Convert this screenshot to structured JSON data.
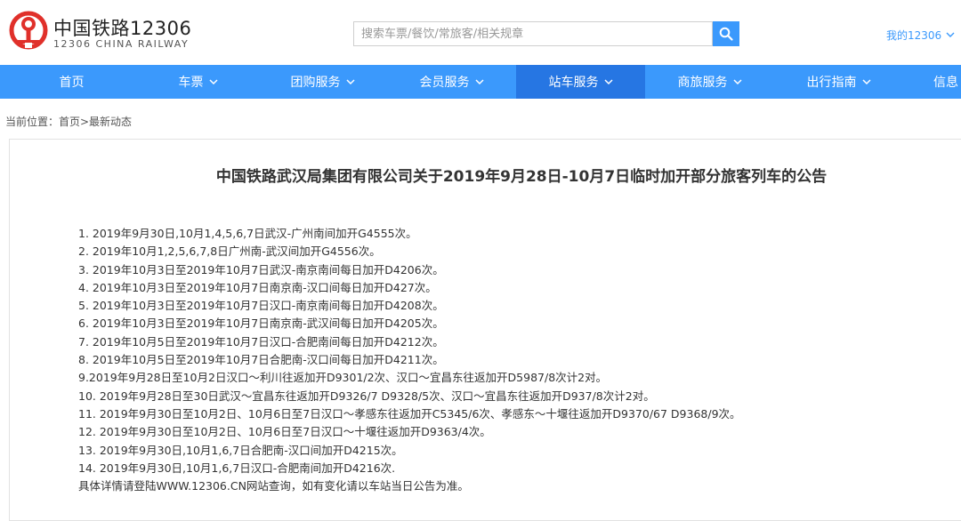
{
  "header": {
    "brand_cn": "中国铁路12306",
    "brand_en": "12306 CHINA RAILWAY",
    "search_placeholder": "搜索车票/餐饮/常旅客/相关规章",
    "account_label": "我的12306"
  },
  "nav": {
    "items": [
      {
        "label": "首页"
      },
      {
        "label": "车票"
      },
      {
        "label": "团购服务"
      },
      {
        "label": "会员服务"
      },
      {
        "label": "站车服务"
      },
      {
        "label": "商旅服务"
      },
      {
        "label": "出行指南"
      },
      {
        "label": "信息"
      }
    ],
    "active": "站车服务"
  },
  "breadcrumb": {
    "text": "当前位置：首页>最新动态"
  },
  "notice": {
    "title": "中国铁路武汉局集团有限公司关于2019年9月28日-10月7日临时加开部分旅客列车的公告",
    "items": [
      "1. 2019年9月30日,10月1,4,5,6,7日武汉-广州南间加开G4555次。",
      "2. 2019年10月1,2,5,6,7,8日广州南-武汉间加开G4556次。",
      "3. 2019年10月3日至2019年10月7日武汉-南京南间每日加开D4206次。",
      "4. 2019年10月3日至2019年10月7日南京南-汉口间每日加开D427次。",
      "5. 2019年10月3日至2019年10月7日汉口-南京南间每日加开D4208次。",
      "6. 2019年10月3日至2019年10月7日南京南-武汉间每日加开D4205次。",
      "7. 2019年10月5日至2019年10月7日汉口-合肥南间每日加开D4212次。",
      "8. 2019年10月5日至2019年10月7日合肥南-汉口间每日加开D4211次。",
      "9.2019年9月28日至10月2日汉口～利川往返加开D9301/2次、汉口～宜昌东往返加开D5987/8次计2对。",
      "10. 2019年9月28日至30日武汉～宜昌东往返加开D9326/7 D9328/5次、汉口～宜昌东往返加开D937/8次计2对。",
      "11. 2019年9月30日至10月2日、10月6日至7日汉口～孝感东往返加开C5345/6次、孝感东～十堰往返加开D9370/67 D9368/9次。",
      "12. 2019年9月30日至10月2日、10月6日至7日汉口～十堰往返加开D9363/4次。",
      "13. 2019年9月30日,10月1,6,7日合肥南-汉口间加开D4215次。",
      "14. 2019年9月30日,10月1,6,7日汉口-合肥南间加开D4216次."
    ],
    "footer": "具体详情请登陆WWW.12306.CN网站查询，如有变化请以车站当日公告为准。"
  },
  "colors": {
    "nav_bg": "#3b99fc",
    "nav_active_bg": "#2676e3",
    "logo_red": "#e0302a"
  },
  "icons": {
    "logo": "china-railway-logo-icon",
    "search": "search-icon",
    "dropdown": "chevron-down-icon"
  }
}
